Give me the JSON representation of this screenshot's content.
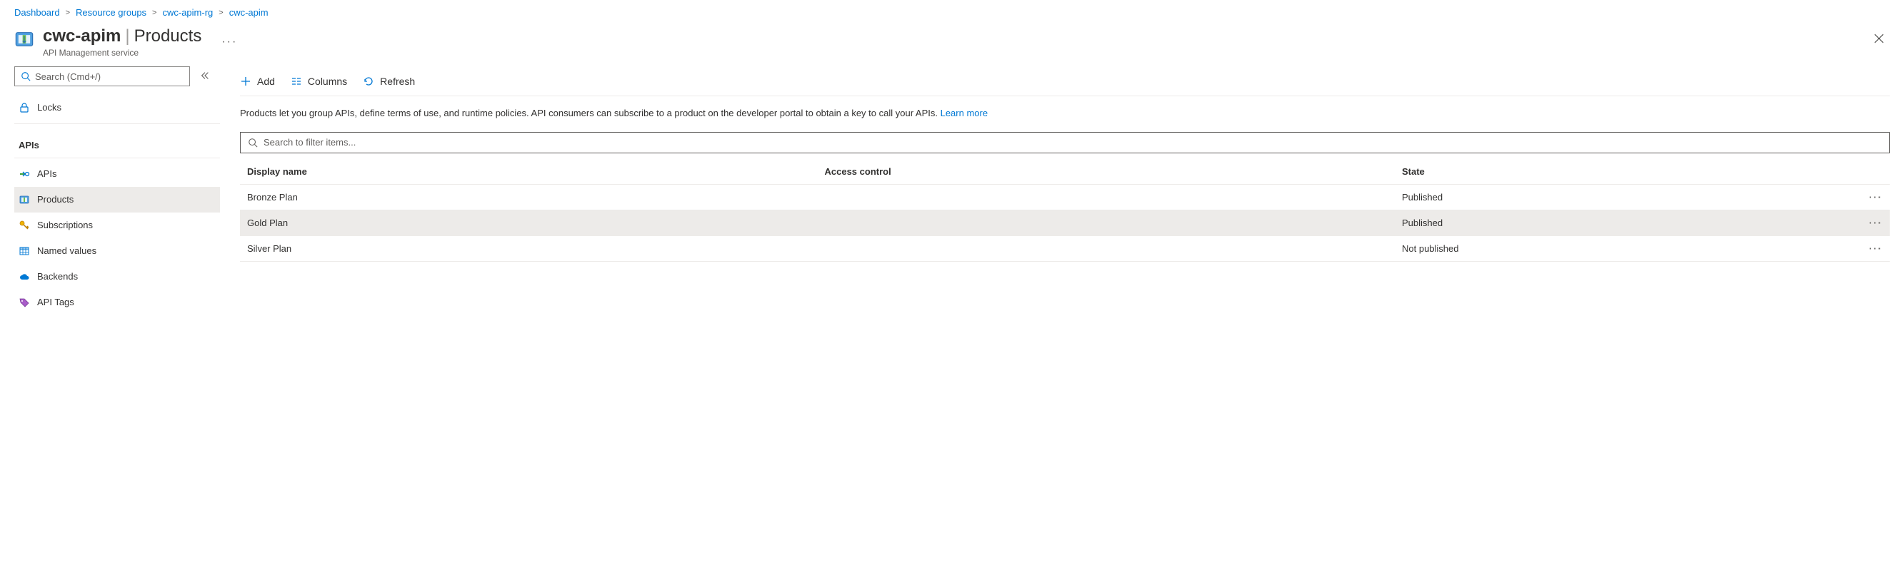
{
  "breadcrumb": {
    "items": [
      {
        "label": "Dashboard"
      },
      {
        "label": "Resource groups"
      },
      {
        "label": "cwc-apim-rg"
      },
      {
        "label": "cwc-apim"
      }
    ]
  },
  "header": {
    "title": "cwc-apim",
    "section": "Products",
    "subtitle": "API Management service"
  },
  "sidebar": {
    "search_placeholder": "Search (Cmd+/)",
    "top": [
      {
        "id": "locks",
        "label": "Locks",
        "icon": "lock"
      }
    ],
    "group_label": "APIs",
    "items": [
      {
        "id": "apis",
        "label": "APIs",
        "icon": "api"
      },
      {
        "id": "products",
        "label": "Products",
        "icon": "product",
        "selected": true
      },
      {
        "id": "subscriptions",
        "label": "Subscriptions",
        "icon": "key"
      },
      {
        "id": "named-values",
        "label": "Named values",
        "icon": "grid"
      },
      {
        "id": "backends",
        "label": "Backends",
        "icon": "cloud"
      },
      {
        "id": "api-tags",
        "label": "API Tags",
        "icon": "tag"
      }
    ]
  },
  "toolbar": {
    "add_label": "Add",
    "columns_label": "Columns",
    "refresh_label": "Refresh"
  },
  "description": {
    "text": "Products let you group APIs, define terms of use, and runtime policies. API consumers can subscribe to a product on the developer portal to obtain a key to call your APIs. ",
    "link": "Learn more"
  },
  "filter": {
    "placeholder": "Search to filter items..."
  },
  "table": {
    "columns": {
      "display_name": "Display name",
      "access_control": "Access control",
      "state": "State"
    },
    "rows": [
      {
        "display_name": "Bronze Plan",
        "access_control": "",
        "state": "Published",
        "hover": false
      },
      {
        "display_name": "Gold Plan",
        "access_control": "",
        "state": "Published",
        "hover": true
      },
      {
        "display_name": "Silver Plan",
        "access_control": "",
        "state": "Not published",
        "hover": false
      }
    ]
  }
}
